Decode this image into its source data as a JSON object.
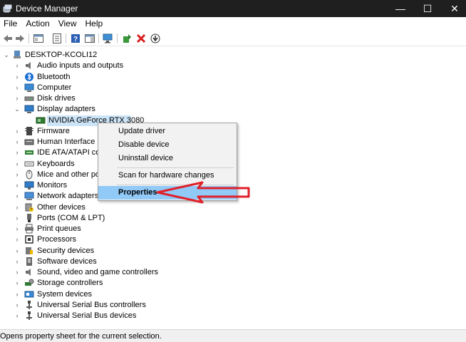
{
  "window": {
    "title": "Device Manager",
    "minimize_glyph": "—",
    "maximize_glyph": "☐",
    "close_glyph": "✕"
  },
  "menu": [
    "File",
    "Action",
    "View",
    "Help"
  ],
  "toolbar_icons": [
    "back-icon",
    "forward-icon",
    "show-hide-console-tree-icon",
    "properties-icon",
    "help-icon",
    "action-pane-icon",
    "monitor-scan-icon",
    "update-driver-icon",
    "uninstall-icon",
    "download-icon"
  ],
  "tree": {
    "root": "DESKTOP-KCOLI12",
    "categories": [
      {
        "label": "Audio inputs and outputs",
        "icon": "speaker-icon"
      },
      {
        "label": "Bluetooth",
        "icon": "bluetooth-icon"
      },
      {
        "label": "Computer",
        "icon": "computer-icon"
      },
      {
        "label": "Disk drives",
        "icon": "disk-drive-icon"
      },
      {
        "label": "Display adapters",
        "icon": "display-adapter-icon",
        "expanded": true
      },
      {
        "label": "Firmware",
        "icon": "firmware-icon"
      },
      {
        "label": "Human Interface D",
        "icon": "hid-icon"
      },
      {
        "label": "IDE ATA/ATAPI cont",
        "icon": "ide-controller-icon"
      },
      {
        "label": "Keyboards",
        "icon": "keyboard-icon"
      },
      {
        "label": "Mice and other poi",
        "icon": "mouse-icon"
      },
      {
        "label": "Monitors",
        "icon": "monitor-icon"
      },
      {
        "label": "Network adapters",
        "icon": "network-adapter-icon"
      },
      {
        "label": "Other devices",
        "icon": "other-devices-icon"
      },
      {
        "label": "Ports (COM & LPT)",
        "icon": "port-icon"
      },
      {
        "label": "Print queues",
        "icon": "printer-icon"
      },
      {
        "label": "Processors",
        "icon": "processor-icon"
      },
      {
        "label": "Security devices",
        "icon": "security-device-icon"
      },
      {
        "label": "Software devices",
        "icon": "software-device-icon"
      },
      {
        "label": "Sound, video and game controllers",
        "icon": "sound-controller-icon"
      },
      {
        "label": "Storage controllers",
        "icon": "storage-controller-icon"
      },
      {
        "label": "System devices",
        "icon": "system-devices-icon"
      },
      {
        "label": "Universal Serial Bus controllers",
        "icon": "usb-icon"
      },
      {
        "label": "Universal Serial Bus devices",
        "icon": "usb-icon"
      }
    ],
    "selected_device": "NVIDIA GeForce RTX 3080"
  },
  "context_menu": {
    "items": [
      "Update driver",
      "Disable device",
      "Uninstall device",
      "Scan for hardware changes",
      "Properties"
    ],
    "highlighted": "Properties"
  },
  "annotation": {
    "color": "#e0202a"
  },
  "status": "Opens property sheet for the current selection.",
  "colors": {
    "titlebar": "#1f1f1f",
    "selection": "#cce4f7",
    "menu_highlight": "#91c9f7",
    "arrow": "#e0202a"
  }
}
